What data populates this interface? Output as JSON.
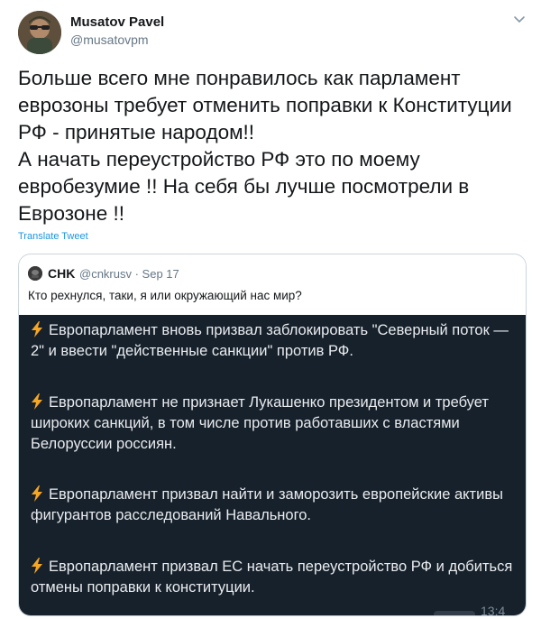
{
  "author": {
    "name": "Musatov Pavel",
    "handle": "@musatovpm"
  },
  "tweet": {
    "text": "Больше всего мне понравилось как парламент еврозоны требует отменить поправки к Конституции РФ - принятые народом!!\nА начать переустройство РФ это по моему евробезумие !! На себя бы лучше посмотрели в Еврозоне !!",
    "translate_label": "Translate Tweet"
  },
  "quoted": {
    "name": "CHK",
    "meta": "@cnkrusv · Sep 17",
    "text": "Кто рехнулся, таки, я или окружающий нас мир?",
    "media": {
      "items": [
        "Европарламент вновь призвал заблокировать \"Северный поток — 2\" и ввести \"действенные санкции\" против РФ.",
        "Европарламент не признает Лукашенко президентом и требует широких санкций, в том числе против работавших с властями Белоруссии россиян.",
        "Европарламент призвал найти и заморозить европейские активы фигурантов расследований Навального.",
        "Европарламент призвал ЕС начать переустройство РФ и добиться отмены поправки к конституции."
      ],
      "time": "13:4",
      "icon": "lightning-icon",
      "bolt_color": "#f5a623"
    }
  },
  "colors": {
    "link": "#1b95e0",
    "muted": "#657786",
    "media_bg": "#17212b"
  }
}
